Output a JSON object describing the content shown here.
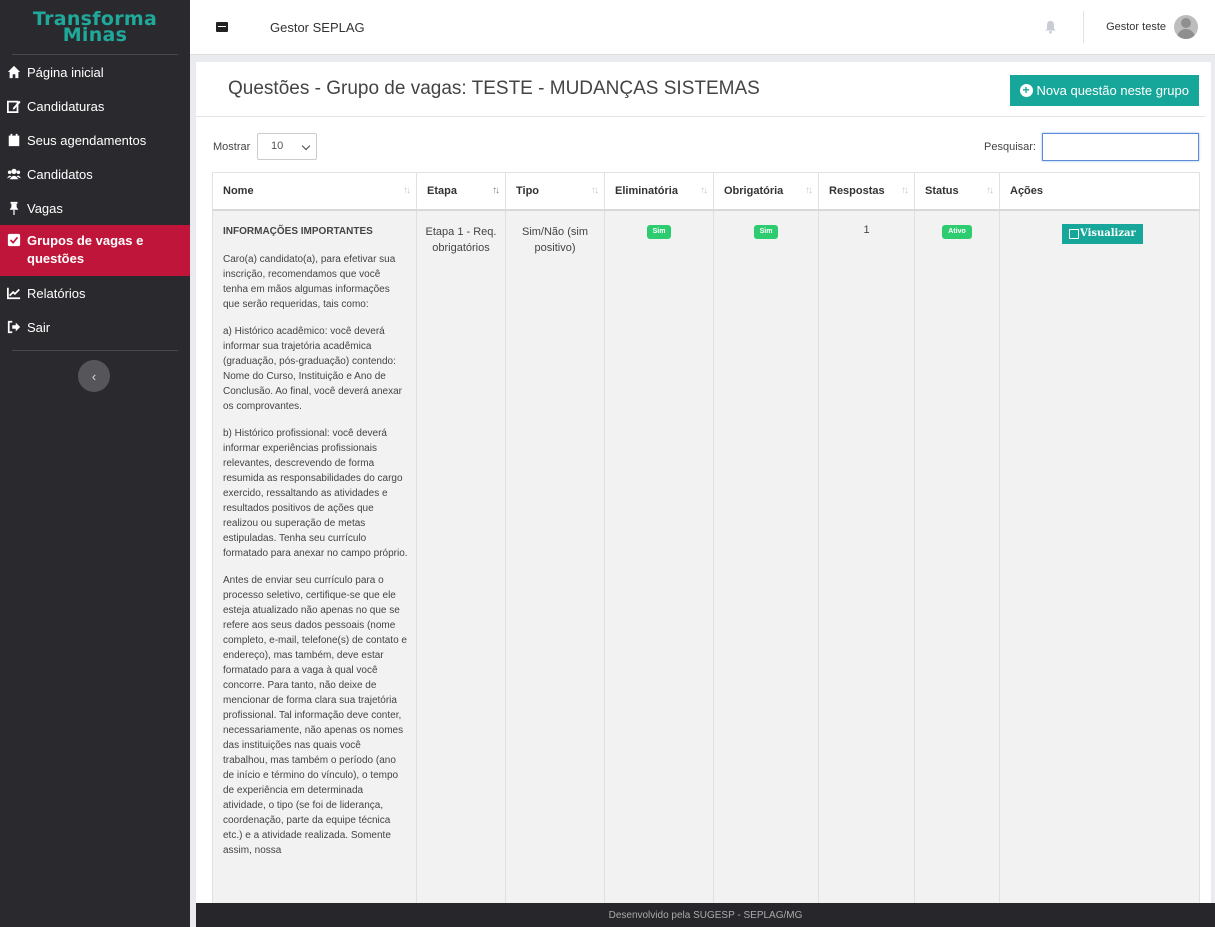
{
  "brand": {
    "line1": "Transforma",
    "line2": "Minas"
  },
  "sidebar": {
    "items": [
      {
        "label": "Página inicial"
      },
      {
        "label": "Candidaturas"
      },
      {
        "label": "Seus agendamentos"
      },
      {
        "label": "Candidatos"
      },
      {
        "label": "Vagas"
      },
      {
        "label": "Grupos de vagas e questões",
        "active": true
      },
      {
        "label": "Relatórios"
      },
      {
        "label": "Sair"
      }
    ],
    "collapse_glyph": "‹"
  },
  "topbar": {
    "app_name": "Gestor SEPLAG",
    "user_name": "Gestor teste"
  },
  "page": {
    "title": "Questões - Grupo de vagas: TESTE - MUDANÇAS SISTEMAS",
    "new_button": "Nova questão neste grupo"
  },
  "table_controls": {
    "show_label": "Mostrar",
    "page_size": "10",
    "search_label": "Pesquisar:",
    "search_value": ""
  },
  "table": {
    "columns": [
      "Nome",
      "Etapa",
      "Tipo",
      "Eliminatória",
      "Obrigatória",
      "Respostas",
      "Status",
      "Ações"
    ],
    "rows": [
      {
        "title": "INFORMAÇÕES IMPORTANTES",
        "paragraphs": [
          "Caro(a) candidato(a), para efetivar sua inscrição, recomendamos que você tenha em mãos algumas informações que serão requeridas, tais como:",
          "a) Histórico acadêmico: você deverá informar sua trajetória acadêmica (graduação, pós-graduação) contendo: Nome do Curso, Instituição e Ano de Conclusão. Ao final, você deverá anexar os comprovantes.",
          "b) Histórico profissional: você deverá informar experiências profissionais relevantes, descrevendo de forma resumida as responsabilidades do cargo exercido, ressaltando as atividades e resultados positivos de ações que realizou ou superação de metas estipuladas. Tenha seu currículo formatado para anexar no campo próprio.",
          "Antes de enviar seu currículo para o processo seletivo, certifique-se que ele esteja atualizado não apenas no que se refere aos seus dados pessoais (nome completo, e-mail, telefone(s) de contato e endereço), mas também, deve estar formatado para a vaga à qual você concorre. Para tanto, não deixe de mencionar de forma clara sua trajetória profissional. Tal informação deve conter, necessariamente, não apenas os nomes das instituições nas quais você trabalhou, mas também o período (ano de início e término do vínculo), o tempo de experiência em determinada atividade, o tipo (se foi de liderança, coordenação, parte da equipe técnica etc.) e a atividade realizada. Somente assim, nossa"
        ],
        "etapa": "Etapa 1 - Req. obrigatórios",
        "tipo": "Sim/Não (sim positivo)",
        "eliminatoria": "Sim",
        "obrigatoria": "Sim",
        "respostas": "1",
        "status": "Ativo",
        "action": "Visualizar"
      }
    ]
  },
  "footer": {
    "text": "Desenvolvido pela SUGESP - SEPLAG/MG"
  },
  "colors": {
    "accent": "#17a79a",
    "active_nav": "#c0153a",
    "sidebar_bg": "#2a2a2e",
    "badge": "#2ecc71"
  }
}
